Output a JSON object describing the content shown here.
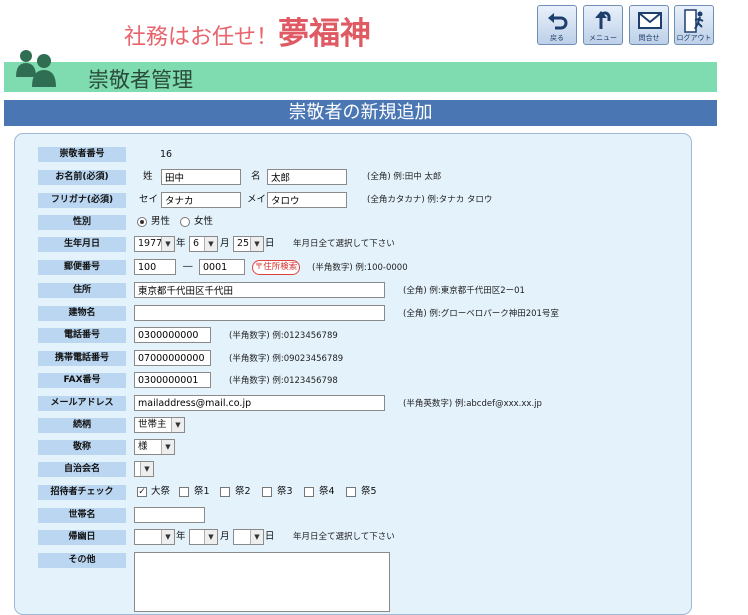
{
  "header": {
    "tagline": "社務はお任せ！",
    "brand": "夢福神",
    "buttons": [
      {
        "label": "戻る",
        "icon": "back-arrow-icon"
      },
      {
        "label": "メニュー",
        "icon": "menu-up-arrow-icon"
      },
      {
        "label": "問合せ",
        "icon": "mail-icon"
      },
      {
        "label": "ログアウト",
        "icon": "logout-icon"
      }
    ]
  },
  "section": {
    "title": "崇敬者管理"
  },
  "page": {
    "title": "崇敬者の新規追加"
  },
  "form": {
    "id": {
      "label": "崇敬者番号",
      "value": "16"
    },
    "name": {
      "label": "お名前(必須)",
      "sei_label": "姓",
      "sei": "田中",
      "mei_label": "名",
      "mei": "太郎",
      "hint": "(全角) 例:田中 太郎"
    },
    "kana": {
      "label": "フリガナ(必須)",
      "sei_label": "セイ",
      "sei": "タナカ",
      "mei_label": "メイ",
      "mei": "タロウ",
      "hint": "(全角カタカナ) 例:タナカ タロウ"
    },
    "gender": {
      "label": "性別",
      "options": [
        "男性",
        "女性"
      ],
      "selected": "男性"
    },
    "birth": {
      "label": "生年月日",
      "year": "1977",
      "month": "6",
      "day": "25",
      "year_unit": "年",
      "month_unit": "月",
      "day_unit": "日",
      "hint": "年月日全て選択して下さい"
    },
    "postal": {
      "label": "郵便番号",
      "first": "100",
      "dash": "―",
      "second": "0001",
      "button": "〒住所検索",
      "hint": "(半角数字) 例:100-0000"
    },
    "address": {
      "label": "住所",
      "value": "東京都千代田区千代田",
      "hint": "(全角) 例:東京都千代田区2ー01"
    },
    "building": {
      "label": "建物名",
      "value": "",
      "hint": "(全角) 例:グローベロパーク神田201号室"
    },
    "phone": {
      "label": "電話番号",
      "value": "0300000000",
      "hint": "(半角数字) 例:0123456789"
    },
    "mobile": {
      "label": "携帯電話番号",
      "value": "07000000000",
      "hint": "(半角数字) 例:09023456789"
    },
    "fax": {
      "label": "FAX番号",
      "value": "0300000001",
      "hint": "(半角数字) 例:0123456798"
    },
    "email": {
      "label": "メールアドレス",
      "value": "mailaddress@mail.co.jp",
      "hint": "(半角英数字) 例:abcdef@xxx.xx.jp"
    },
    "relation": {
      "label": "続柄",
      "value": "世帯主"
    },
    "honorific": {
      "label": "敬称",
      "value": "様"
    },
    "association": {
      "label": "自治会名",
      "value": ""
    },
    "invites": {
      "label": "招待者チェック",
      "items": [
        {
          "label": "大祭",
          "checked": true
        },
        {
          "label": "祭1",
          "checked": false
        },
        {
          "label": "祭2",
          "checked": false
        },
        {
          "label": "祭3",
          "checked": false
        },
        {
          "label": "祭4",
          "checked": false
        },
        {
          "label": "祭5",
          "checked": false
        }
      ]
    },
    "household": {
      "label": "世帯名",
      "value": ""
    },
    "death": {
      "label": "帰幽日",
      "year_unit": "年",
      "month_unit": "月",
      "day_unit": "日",
      "hint": "年月日全て選択して下さい"
    },
    "other": {
      "label": "その他",
      "value": ""
    }
  },
  "colors": {
    "accent_green": "#7fdbb0",
    "title_blue": "#4a77b4",
    "label_blue": "#bad6f1",
    "brand_red": "#e05a64"
  }
}
